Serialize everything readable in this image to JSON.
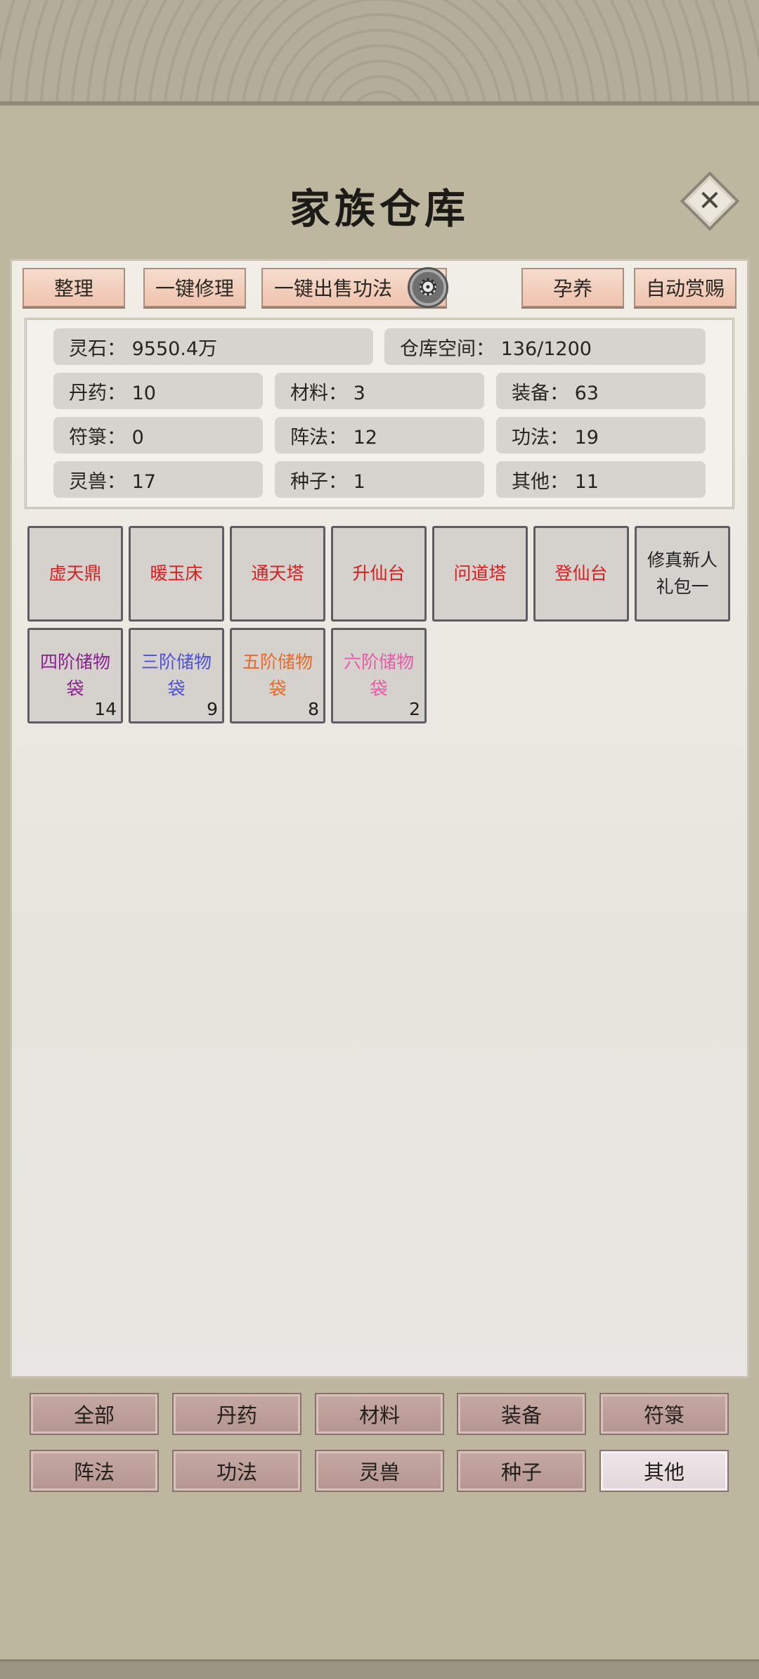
{
  "title": "家族仓库",
  "close_icon": "close-icon",
  "toolbar": {
    "sort": "整理",
    "repair": "一键修理",
    "sell": "一键出售功法",
    "nurture": "孕养",
    "auto_reward": "自动赏赐",
    "gear_icon": "gear-icon"
  },
  "stats": {
    "spirit_stone": "灵石：  9550.4万",
    "capacity": "仓库空间：    136/1200",
    "pills": "丹药：  10",
    "materials": "材料：  3",
    "equipment": "装备：  63",
    "talismans": "符箓：  0",
    "formations": "阵法：  12",
    "techniques": "功法：  19",
    "beasts": "灵兽：  17",
    "seeds": "种子：  1",
    "others": "其他：  11"
  },
  "items": [
    {
      "name": "虚天鼎",
      "color": "#d81e1e",
      "count": ""
    },
    {
      "name": "暖玉床",
      "color": "#d81e1e",
      "count": ""
    },
    {
      "name": "通天塔",
      "color": "#d81e1e",
      "count": ""
    },
    {
      "name": "升仙台",
      "color": "#d81e1e",
      "count": ""
    },
    {
      "name": "问道塔",
      "color": "#d81e1e",
      "count": ""
    },
    {
      "name": "登仙台",
      "color": "#d81e1e",
      "count": ""
    },
    {
      "name": "修真新人礼包一",
      "color": "#222222",
      "count": ""
    },
    {
      "name": "四阶储物袋",
      "color": "#8a1f8e",
      "count": "14"
    },
    {
      "name": "三阶储物袋",
      "color": "#4f4fd6",
      "count": "9"
    },
    {
      "name": "五阶储物袋",
      "color": "#e86a2a",
      "count": "8"
    },
    {
      "name": "六阶储物袋",
      "color": "#e85aa8",
      "count": "2"
    }
  ],
  "categories": [
    "全部",
    "丹药",
    "材料",
    "装备",
    "符箓",
    "阵法",
    "功法",
    "灵兽",
    "种子",
    "其他"
  ],
  "active_category": "其他"
}
